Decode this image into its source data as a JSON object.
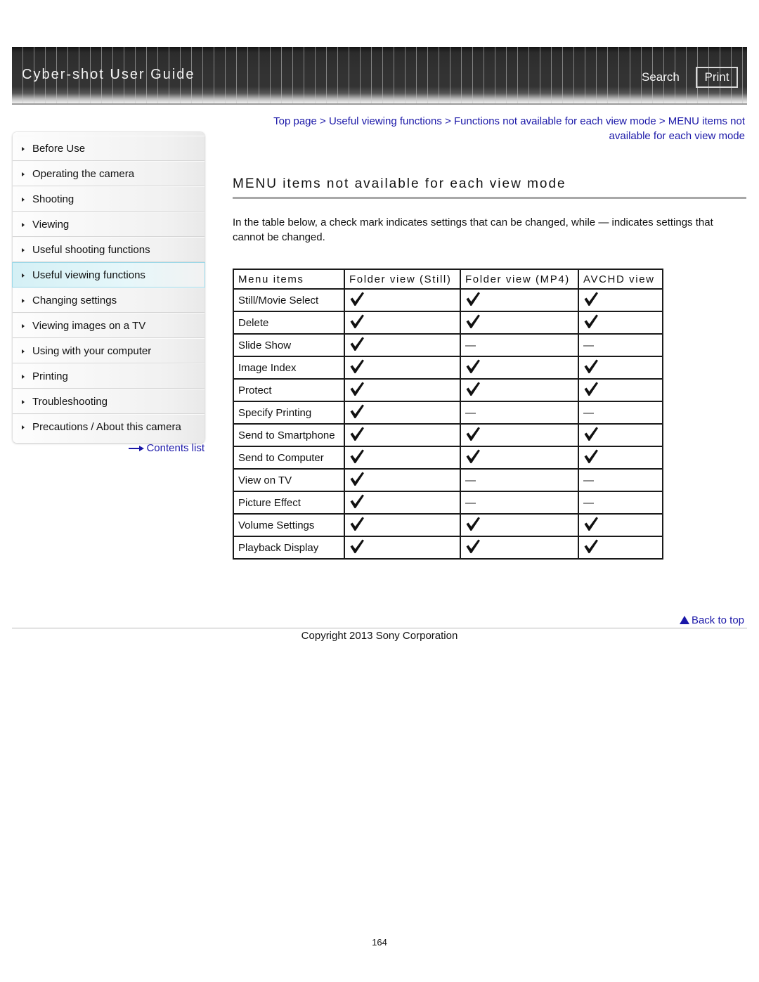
{
  "header": {
    "title": "Cyber-shot User Guide",
    "search_label": "Search",
    "print_label": "Print"
  },
  "sidebar": {
    "items": [
      {
        "label": "Before Use",
        "active": false
      },
      {
        "label": "Operating the camera",
        "active": false
      },
      {
        "label": "Shooting",
        "active": false
      },
      {
        "label": "Viewing",
        "active": false
      },
      {
        "label": "Useful shooting functions",
        "active": false
      },
      {
        "label": "Useful viewing functions",
        "active": true
      },
      {
        "label": "Changing settings",
        "active": false
      },
      {
        "label": "Viewing images on a TV",
        "active": false
      },
      {
        "label": "Using with your computer",
        "active": false
      },
      {
        "label": "Printing",
        "active": false
      },
      {
        "label": "Troubleshooting",
        "active": false
      },
      {
        "label": "Precautions / About this camera",
        "active": false
      }
    ],
    "contents_link": "Contents list"
  },
  "breadcrumb": {
    "items": [
      "Top page",
      "Useful viewing functions",
      "Functions not available for each view mode",
      "MENU items not available for each view mode"
    ],
    "separator": ">"
  },
  "main": {
    "title": "MENU items not available for each view mode",
    "intro": "In the table below, a check mark indicates settings that can be changed, while — indicates settings that cannot be changed.",
    "table": {
      "headers": [
        "Menu items",
        "Folder view (Still)",
        "Folder view (MP4)",
        "AVCHD view"
      ],
      "rows": [
        {
          "item": "Still/Movie Select",
          "values": [
            "check",
            "check",
            "check"
          ]
        },
        {
          "item": "Delete",
          "values": [
            "check",
            "check",
            "check"
          ]
        },
        {
          "item": "Slide Show",
          "values": [
            "check",
            "dash",
            "dash"
          ]
        },
        {
          "item": "Image Index",
          "values": [
            "check",
            "check",
            "check"
          ]
        },
        {
          "item": "Protect",
          "values": [
            "check",
            "check",
            "check"
          ]
        },
        {
          "item": "Specify Printing",
          "values": [
            "check",
            "dash",
            "dash"
          ]
        },
        {
          "item": "Send to Smartphone",
          "values": [
            "check",
            "check",
            "check"
          ]
        },
        {
          "item": "Send to Computer",
          "values": [
            "check",
            "check",
            "check"
          ]
        },
        {
          "item": "View on TV",
          "values": [
            "check",
            "dash",
            "dash"
          ]
        },
        {
          "item": "Picture Effect",
          "values": [
            "check",
            "dash",
            "dash"
          ]
        },
        {
          "item": "Volume Settings",
          "values": [
            "check",
            "check",
            "check"
          ]
        },
        {
          "item": "Playback Display",
          "values": [
            "check",
            "check",
            "check"
          ]
        }
      ],
      "dash_symbol": "—"
    }
  },
  "footer": {
    "back_to_top": "Back to top",
    "copyright": "Copyright 2013 Sony Corporation",
    "page_number": "164"
  },
  "colors": {
    "link": "#1a17a8",
    "banner_bg": "#333333",
    "active_nav_bg": "#d4f0f5",
    "active_nav_border": "#9ad8e8"
  }
}
